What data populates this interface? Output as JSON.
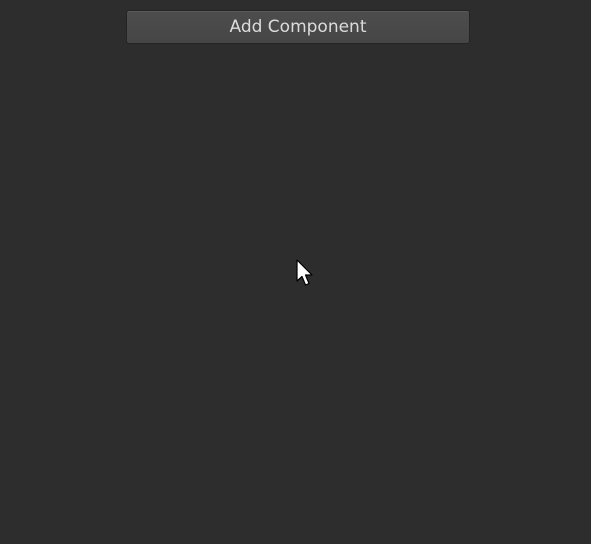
{
  "inspector": {
    "add_component_label": "Add Component"
  },
  "cursor": {
    "icon": "arrow-pointer-icon"
  },
  "colors": {
    "background": "#2d2d2d",
    "button_bg": "#4a4a4a",
    "button_text": "#dcdcdc",
    "cursor_fill": "#ffffff",
    "cursor_stroke": "#000000"
  }
}
